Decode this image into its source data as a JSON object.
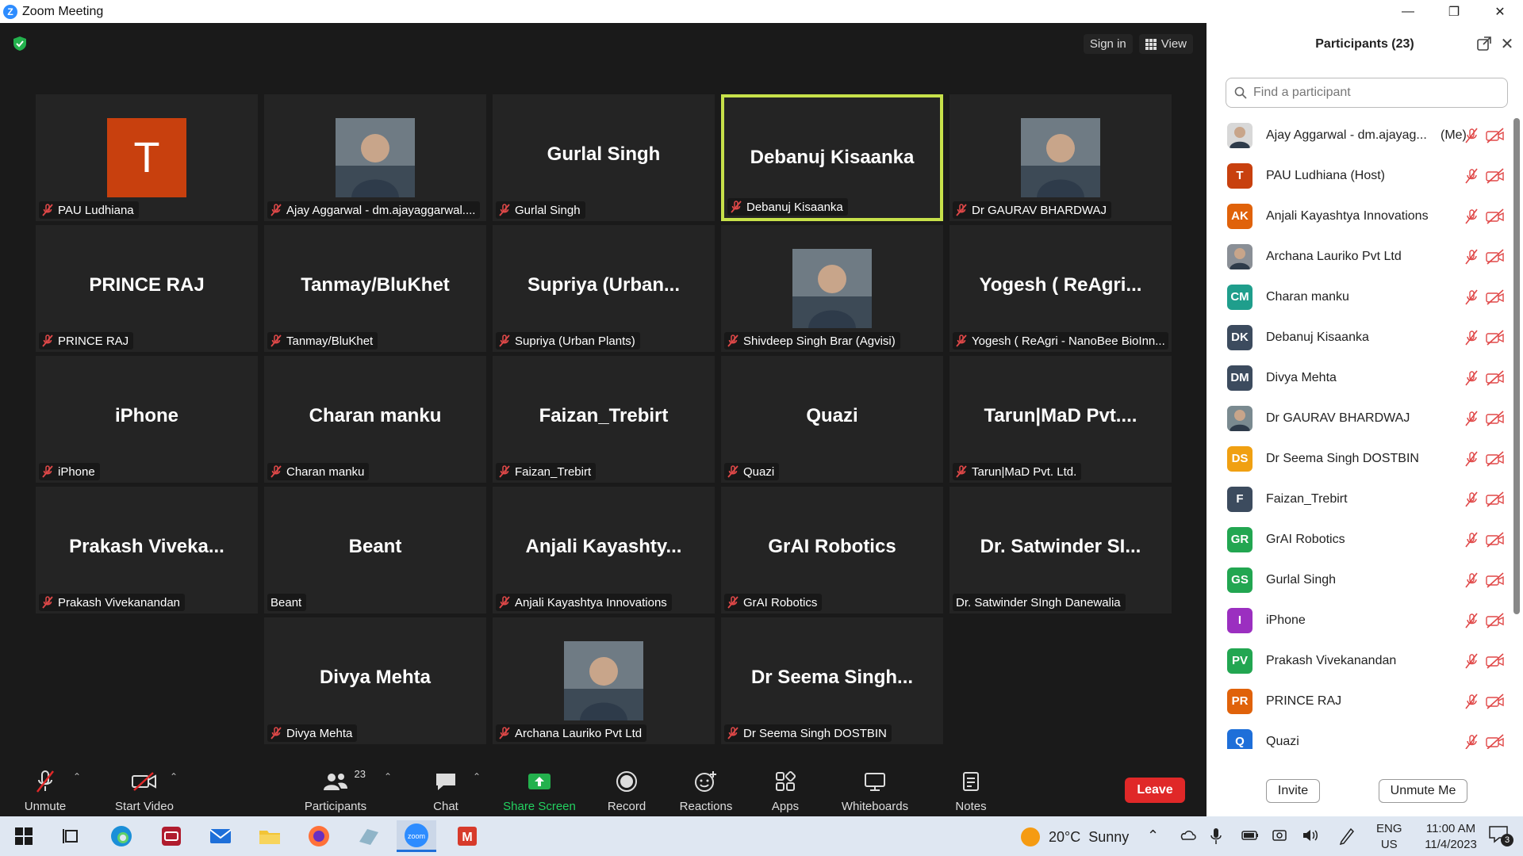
{
  "window": {
    "title": "Zoom Meeting",
    "logo_letter": "Z"
  },
  "meeting": {
    "sign_in": "Sign in",
    "view": "View",
    "tiles": [
      {
        "big": "T",
        "cap": "PAU Ludhiana",
        "muted": true,
        "kind": "letter",
        "color": "#C8400E"
      },
      {
        "big": "",
        "cap": "Ajay Aggarwal - dm.ajayaggarwal....",
        "muted": true,
        "kind": "photo"
      },
      {
        "big": "Gurlal Singh",
        "cap": "Gurlal Singh",
        "muted": true,
        "kind": "name"
      },
      {
        "big": "Debanuj Kisaanka",
        "cap": "Debanuj Kisaanka",
        "muted": true,
        "kind": "name",
        "speaking": true
      },
      {
        "big": "",
        "cap": "Dr GAURAV BHARDWAJ",
        "muted": true,
        "kind": "photo"
      },
      {
        "big": "PRINCE RAJ",
        "cap": "PRINCE RAJ",
        "muted": true,
        "kind": "name"
      },
      {
        "big": "Tanmay/BluKhet",
        "cap": "Tanmay/BluKhet",
        "muted": true,
        "kind": "name"
      },
      {
        "big": "Supriya (Urban...",
        "cap": "Supriya (Urban Plants)",
        "muted": true,
        "kind": "name"
      },
      {
        "big": "",
        "cap": "Shivdeep Singh Brar (Agvisi)",
        "muted": true,
        "kind": "photo"
      },
      {
        "big": "Yogesh ( ReAgri...",
        "cap": "Yogesh ( ReAgri - NanoBee BioInn...",
        "muted": true,
        "kind": "name"
      },
      {
        "big": "iPhone",
        "cap": "iPhone",
        "muted": true,
        "kind": "name"
      },
      {
        "big": "Charan manku",
        "cap": "Charan manku",
        "muted": true,
        "kind": "name"
      },
      {
        "big": "Faizan_Trebirt",
        "cap": "Faizan_Trebirt",
        "muted": true,
        "kind": "name"
      },
      {
        "big": "Quazi",
        "cap": "Quazi",
        "muted": true,
        "kind": "name"
      },
      {
        "big": "Tarun|MaD Pvt....",
        "cap": "Tarun|MaD Pvt. Ltd.",
        "muted": true,
        "kind": "name"
      },
      {
        "big": "Prakash Viveka...",
        "cap": "Prakash Vivekanandan",
        "muted": true,
        "kind": "name"
      },
      {
        "big": "Beant",
        "cap": "Beant",
        "muted": false,
        "kind": "name"
      },
      {
        "big": "Anjali Kayashty...",
        "cap": "Anjali Kayashtya Innovations",
        "muted": true,
        "kind": "name"
      },
      {
        "big": "GrAI Robotics",
        "cap": "GrAI Robotics",
        "muted": true,
        "kind": "name"
      },
      {
        "big": "Dr. Satwinder SI...",
        "cap": "Dr. Satwinder SIngh Danewalia",
        "muted": false,
        "kind": "name"
      },
      {
        "big": "Divya Mehta",
        "cap": "Divya Mehta",
        "muted": true,
        "kind": "name"
      },
      {
        "big": "",
        "cap": "Archana Lauriko Pvt Ltd",
        "muted": true,
        "kind": "photo"
      },
      {
        "big": "Dr Seema Singh...",
        "cap": "Dr Seema Singh DOSTBIN",
        "muted": true,
        "kind": "name"
      }
    ]
  },
  "toolbar": {
    "unmute": "Unmute",
    "start_video": "Start Video",
    "participants": "Participants",
    "participants_count": "23",
    "chat": "Chat",
    "share_screen": "Share Screen",
    "record": "Record",
    "reactions": "Reactions",
    "apps": "Apps",
    "whiteboards": "Whiteboards",
    "notes": "Notes",
    "leave": "Leave"
  },
  "panel": {
    "title": "Participants (23)",
    "search_placeholder": "Find a participant",
    "participants": [
      {
        "name": "Ajay Aggarwal - dm.ajayag...",
        "suffix": "(Me)",
        "initials": "",
        "color": "#d8d8d8",
        "photo": true
      },
      {
        "name": "PAU Ludhiana (Host)",
        "suffix": "",
        "initials": "T",
        "color": "#C8400E",
        "photo": false
      },
      {
        "name": "Anjali Kayashtya Innovations",
        "suffix": "",
        "initials": "AK",
        "color": "#E0620A",
        "photo": false
      },
      {
        "name": "Archana Lauriko Pvt Ltd",
        "suffix": "",
        "initials": "",
        "color": "#8a8f96",
        "photo": true
      },
      {
        "name": "Charan manku",
        "suffix": "",
        "initials": "CM",
        "color": "#1F9E8C",
        "photo": false
      },
      {
        "name": "Debanuj Kisaanka",
        "suffix": "",
        "initials": "DK",
        "color": "#3C4B5E",
        "photo": false
      },
      {
        "name": "Divya Mehta",
        "suffix": "",
        "initials": "DM",
        "color": "#3C4B5E",
        "photo": false
      },
      {
        "name": "Dr GAURAV BHARDWAJ",
        "suffix": "",
        "initials": "",
        "color": "#7a8a90",
        "photo": true
      },
      {
        "name": "Dr Seema Singh DOSTBIN",
        "suffix": "",
        "initials": "DS",
        "color": "#F0A012",
        "photo": false
      },
      {
        "name": "Faizan_Trebirt",
        "suffix": "",
        "initials": "F",
        "color": "#3C4B5E",
        "photo": false
      },
      {
        "name": "GrAI Robotics",
        "suffix": "",
        "initials": "GR",
        "color": "#22A651",
        "photo": false
      },
      {
        "name": "Gurlal Singh",
        "suffix": "",
        "initials": "GS",
        "color": "#22A651",
        "photo": false
      },
      {
        "name": "iPhone",
        "suffix": "",
        "initials": "I",
        "color": "#9B2FC0",
        "photo": false
      },
      {
        "name": "Prakash Vivekanandan",
        "suffix": "",
        "initials": "PV",
        "color": "#22A651",
        "photo": false
      },
      {
        "name": "PRINCE RAJ",
        "suffix": "",
        "initials": "PR",
        "color": "#E0620A",
        "photo": false
      },
      {
        "name": "Quazi",
        "suffix": "",
        "initials": "Q",
        "color": "#1E6FD9",
        "photo": false
      }
    ],
    "invite": "Invite",
    "unmute_me": "Unmute Me"
  },
  "taskbar": {
    "temperature": "20°C",
    "condition": "Sunny",
    "lang_top": "ENG",
    "lang_bottom": "US",
    "time": "11:00 AM",
    "date": "11/4/2023",
    "notification_count": "3"
  }
}
